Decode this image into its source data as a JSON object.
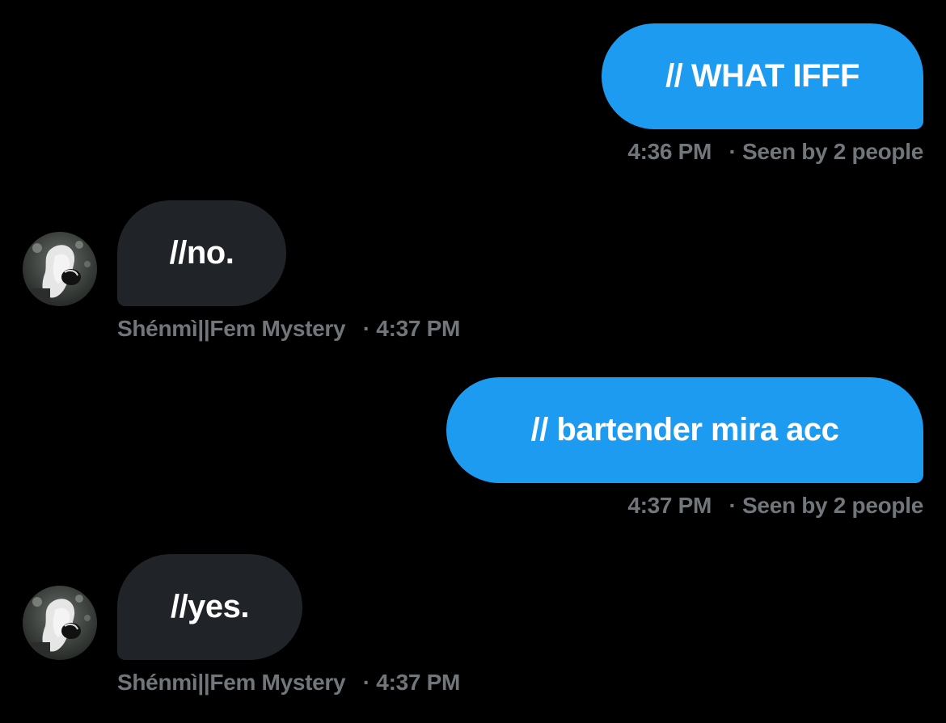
{
  "conversation": {
    "messages": [
      {
        "direction": "outgoing",
        "text": "// WHAT IFFF",
        "time": "4:36 PM",
        "status": "Seen by 2 people"
      },
      {
        "direction": "incoming",
        "text": "//no.",
        "sender": "Shénmì||Fem Mystery",
        "time": "4:37 PM"
      },
      {
        "direction": "outgoing",
        "text": "// bartender mira acc",
        "time": "4:37 PM",
        "status": "Seen by 2 people"
      },
      {
        "direction": "incoming",
        "text": "//yes.",
        "sender": "Shénmì||Fem Mystery",
        "time": "4:37 PM"
      }
    ]
  },
  "meta": {
    "separator": "·"
  },
  "colors": {
    "background": "#000000",
    "outgoing_bubble": "#1d9bf0",
    "incoming_bubble": "#202327",
    "meta_text": "#71767b"
  },
  "icons": {
    "avatar": "profile-photo"
  }
}
